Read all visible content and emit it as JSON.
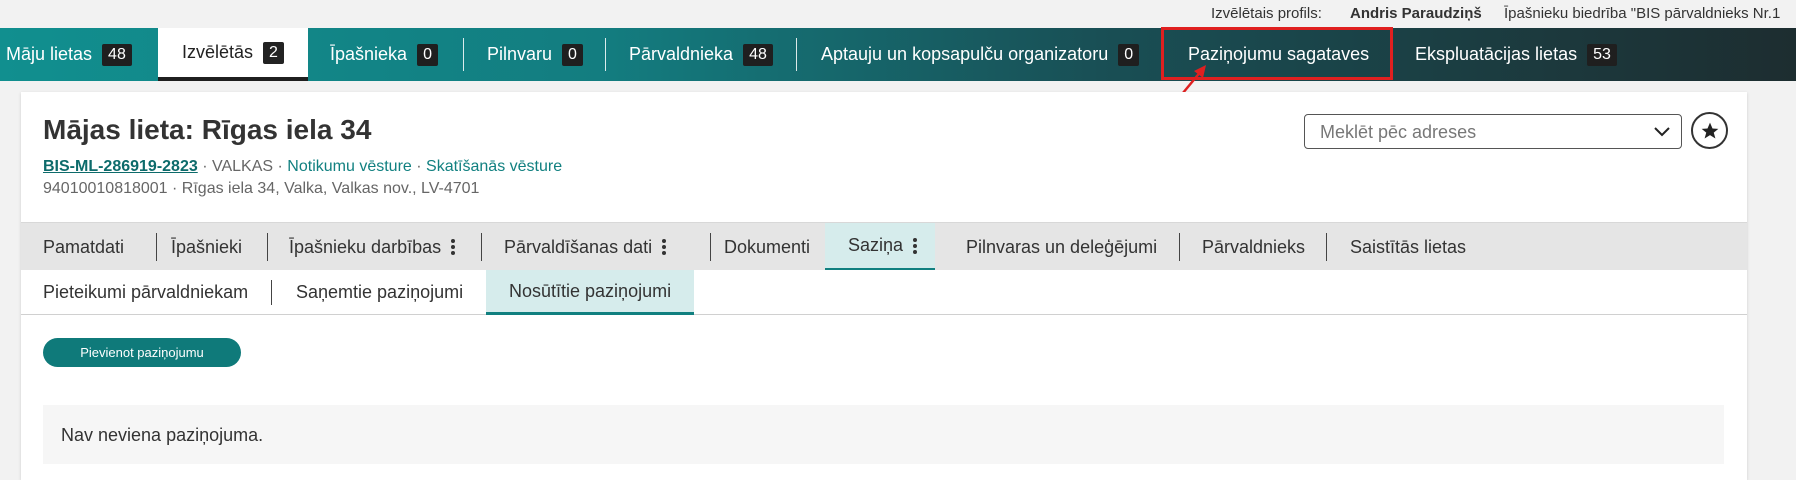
{
  "profile": {
    "label": "Izvēlētais profils:",
    "name": "Andris Paraudziņš",
    "organization": "Īpašnieku biedrība \"BIS pārvaldnieks Nr.1"
  },
  "main_nav": {
    "tabs": [
      {
        "label": "Māju lietas",
        "count": "48"
      },
      {
        "label": "Izvēlētās",
        "count": "2"
      },
      {
        "label": "Īpašnieka",
        "count": "0"
      },
      {
        "label": "Pilnvaru",
        "count": "0"
      },
      {
        "label": "Pārvaldnieka",
        "count": "48"
      },
      {
        "label": "Aptauju un kopsapulču organizatoru",
        "count": "0"
      },
      {
        "label": "Paziņojumu sagataves"
      },
      {
        "label": "Ekspluatācijas lietas",
        "count": "53"
      }
    ],
    "highlight_color": "#e02020"
  },
  "case": {
    "title": "Mājas lieta: Rīgas iela 34",
    "code": "BIS-ML-286919-2823",
    "municipality": "VALKAS",
    "event_history_link": "Notikumu vēsture",
    "view_history_link": "Skatīšanās vēsture",
    "address_line": "94010010818001 · Rīgas iela 34, Valka, Valkas nov., LV-4701"
  },
  "search": {
    "placeholder": "Meklēt pēc adreses"
  },
  "section_tabs": [
    {
      "label": "Pamatdati"
    },
    {
      "label": "Īpašnieki"
    },
    {
      "label": "Īpašnieku darbības"
    },
    {
      "label": "Pārvaldīšanas dati"
    },
    {
      "label": "Dokumenti"
    },
    {
      "label": "Saziņa"
    },
    {
      "label": "Pilnvaras un deleģējumi"
    },
    {
      "label": "Pārvaldnieks"
    },
    {
      "label": "Saistītās lietas"
    }
  ],
  "sub_tabs": [
    {
      "label": "Pieteikumi pārvaldniekam"
    },
    {
      "label": "Saņemtie paziņojumi"
    },
    {
      "label": "Nosūtītie paziņojumi"
    }
  ],
  "add_button_label": "Pievienot paziņojumu",
  "empty_message": "Nav neviena paziņojuma.",
  "colors": {
    "teal": "#118080",
    "dark_nav": "#1d2d30",
    "badge": "#1f1f1f"
  }
}
